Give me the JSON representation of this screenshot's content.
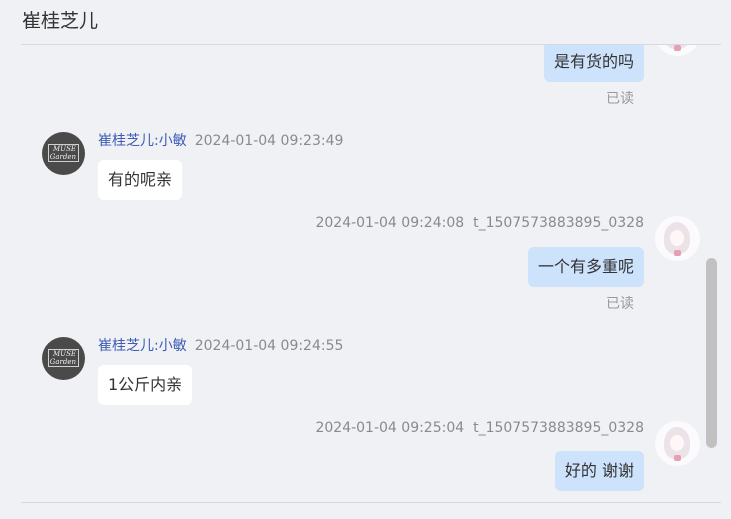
{
  "header": {
    "title": "崔桂芝儿"
  },
  "messages": [
    {
      "direction": "out",
      "text": "是有货的吗",
      "status": "已读"
    },
    {
      "direction": "in",
      "sender": "崔桂芝儿:小敏",
      "time": "2024-01-04 09:23:49",
      "text": "有的呢亲",
      "avatar_logo": "MUSE Garden"
    },
    {
      "direction": "out",
      "time": "2024-01-04 09:24:08",
      "sender": "t_1507573883895_0328",
      "text": "一个有多重呢",
      "status": "已读"
    },
    {
      "direction": "in",
      "sender": "崔桂芝儿:小敏",
      "time": "2024-01-04 09:24:55",
      "text": "1公斤内亲",
      "avatar_logo": "MUSE Garden"
    },
    {
      "direction": "out",
      "time": "2024-01-04 09:25:04",
      "sender": "t_1507573883895_0328",
      "text": "好的 谢谢"
    }
  ],
  "colors": {
    "outgoing_bubble": "#cde2fb",
    "incoming_bubble": "#ffffff",
    "background": "#f0f1f5",
    "nickname": "#3d5bb3"
  }
}
